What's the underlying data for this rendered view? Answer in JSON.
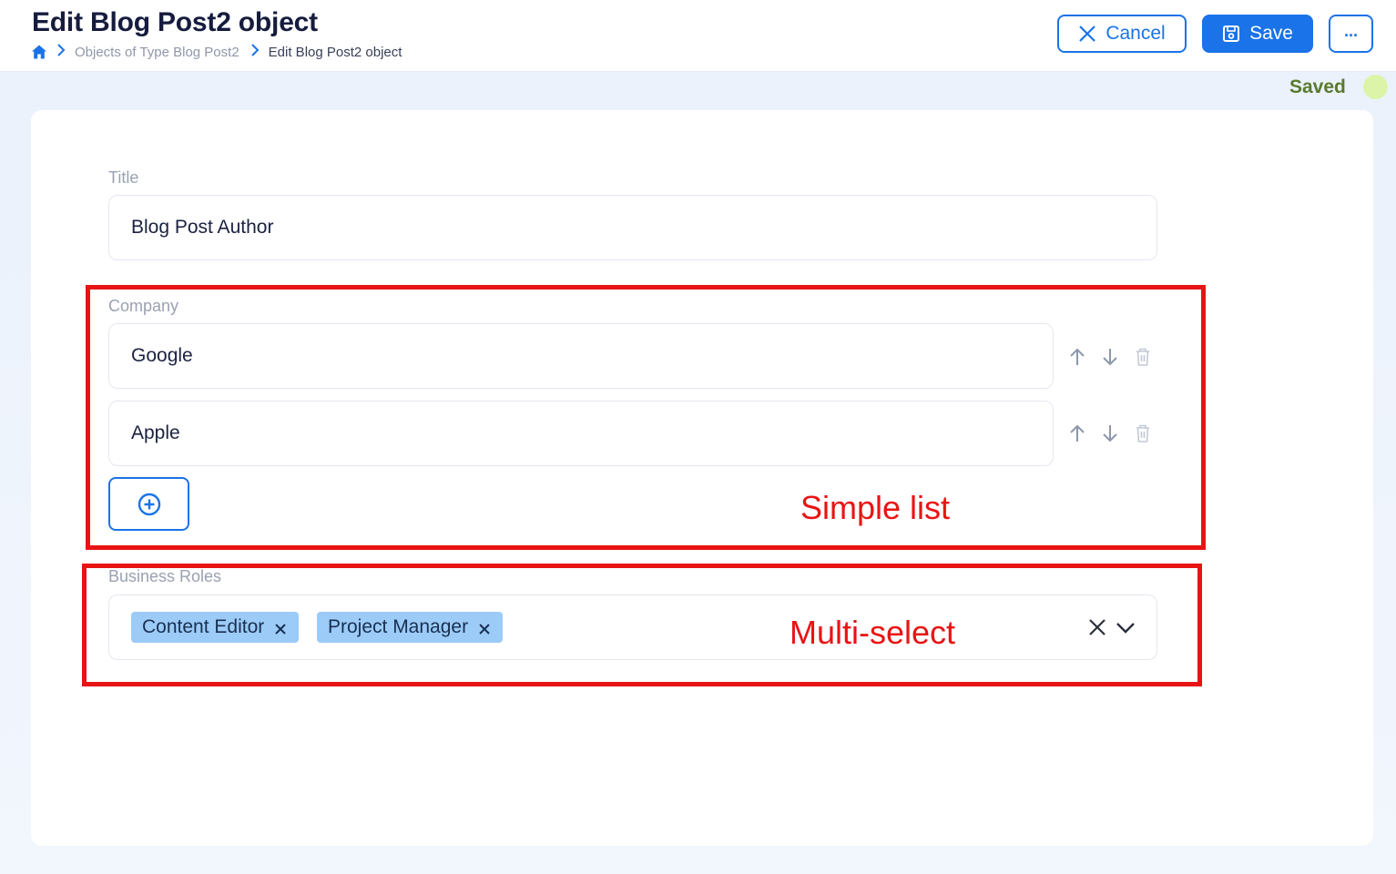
{
  "header": {
    "title": "Edit Blog Post2 object",
    "breadcrumb": {
      "link": "Objects of Type Blog Post2",
      "current": "Edit Blog Post2 object"
    },
    "buttons": {
      "cancel": "Cancel",
      "save": "Save",
      "more": "..."
    }
  },
  "status": {
    "saved": "Saved"
  },
  "form": {
    "title": {
      "label": "Title",
      "value": "Blog Post Author"
    },
    "company": {
      "label": "Company",
      "items": [
        "Google",
        "Apple"
      ]
    },
    "business_roles": {
      "label": "Business Roles",
      "tags": [
        "Content Editor",
        "Project Manager"
      ]
    }
  },
  "annotations": {
    "simple_list": "Simple list",
    "multi_select": "Multi-select"
  },
  "colors": {
    "accent": "#1a73e8",
    "annotation": "#e81414",
    "tag_bg": "#9ccbf7",
    "saved_dot": "#dcf4a8"
  }
}
